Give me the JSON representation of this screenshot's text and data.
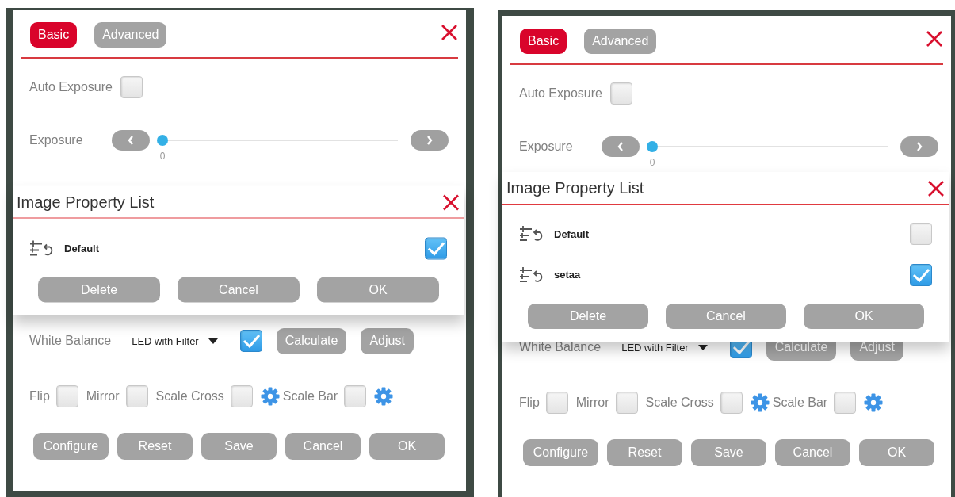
{
  "panels": [
    {
      "tabs": [
        {
          "label": "Basic",
          "selected": true
        },
        {
          "label": "Advanced",
          "selected": false
        }
      ],
      "auto_exposure": {
        "label": "Auto Exposure",
        "checked": false
      },
      "exposure": {
        "label": "Exposure",
        "level": 0,
        "reading": "0"
      },
      "white_balance": {
        "label": "White Balance",
        "value": "LED with Filter",
        "checked": true,
        "buttons": [
          "Calculate",
          "Adjust"
        ]
      },
      "toggles": [
        {
          "label": "Flip",
          "checked": false,
          "has_settings": false
        },
        {
          "label": "Mirror",
          "checked": false,
          "has_settings": false
        },
        {
          "label": "Scale Cross",
          "checked": false,
          "has_settings": true
        },
        {
          "label": "Scale Bar",
          "checked": false,
          "has_settings": true
        }
      ],
      "buttons": [
        "Configure",
        "Reset",
        "Save",
        "Cancel",
        "OK"
      ],
      "property_list": {
        "title": "Image Property List",
        "items": [
          {
            "name": "Default",
            "selected": true
          }
        ],
        "buttons": [
          "Delete",
          "Cancel",
          "OK"
        ]
      }
    },
    {
      "tabs": [
        {
          "label": "Basic",
          "selected": true
        },
        {
          "label": "Advanced",
          "selected": false
        }
      ],
      "auto_exposure": {
        "label": "Auto Exposure",
        "checked": false
      },
      "exposure": {
        "label": "Exposure",
        "level": 0,
        "reading": "0"
      },
      "white_balance": {
        "label": "White Balance",
        "value": "LED with Filter",
        "checked": true,
        "buttons": [
          "Calculate",
          "Adjust"
        ]
      },
      "toggles": [
        {
          "label": "Flip",
          "checked": false,
          "has_settings": false
        },
        {
          "label": "Mirror",
          "checked": false,
          "has_settings": false
        },
        {
          "label": "Scale Cross",
          "checked": false,
          "has_settings": true
        },
        {
          "label": "Scale Bar",
          "checked": false,
          "has_settings": true
        }
      ],
      "buttons": [
        "Configure",
        "Reset",
        "Save",
        "Cancel",
        "OK"
      ],
      "property_list": {
        "title": "Image Property List",
        "items": [
          {
            "name": "Default",
            "selected": false
          },
          {
            "name": "setaa",
            "selected": true
          }
        ],
        "buttons": [
          "Delete",
          "Cancel",
          "OK"
        ]
      }
    }
  ]
}
